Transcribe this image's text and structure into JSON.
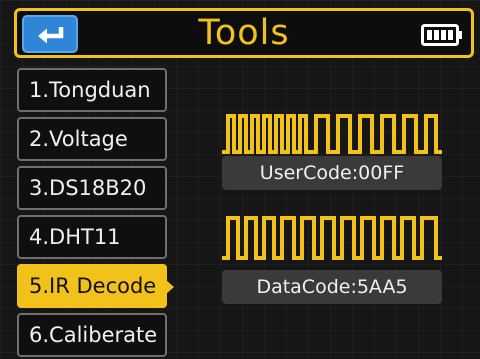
{
  "header": {
    "title": "Tools",
    "back_icon": "return-arrow-icon",
    "battery_icon": "battery-full-icon"
  },
  "menu": {
    "items": [
      {
        "label": "1.Tongduan"
      },
      {
        "label": "2.Voltage"
      },
      {
        "label": "3.DS18B20"
      },
      {
        "label": "4.DHT11"
      },
      {
        "label": "5.IR Decode"
      },
      {
        "label": "6.Caliberate"
      }
    ],
    "selected_index": 4
  },
  "ir": {
    "user_code": "UserCode:00FF",
    "data_code": "DataCode:5AA5"
  },
  "colors": {
    "accent": "#f2c21b",
    "back_button": "#2f86d6",
    "background": "#161616"
  }
}
